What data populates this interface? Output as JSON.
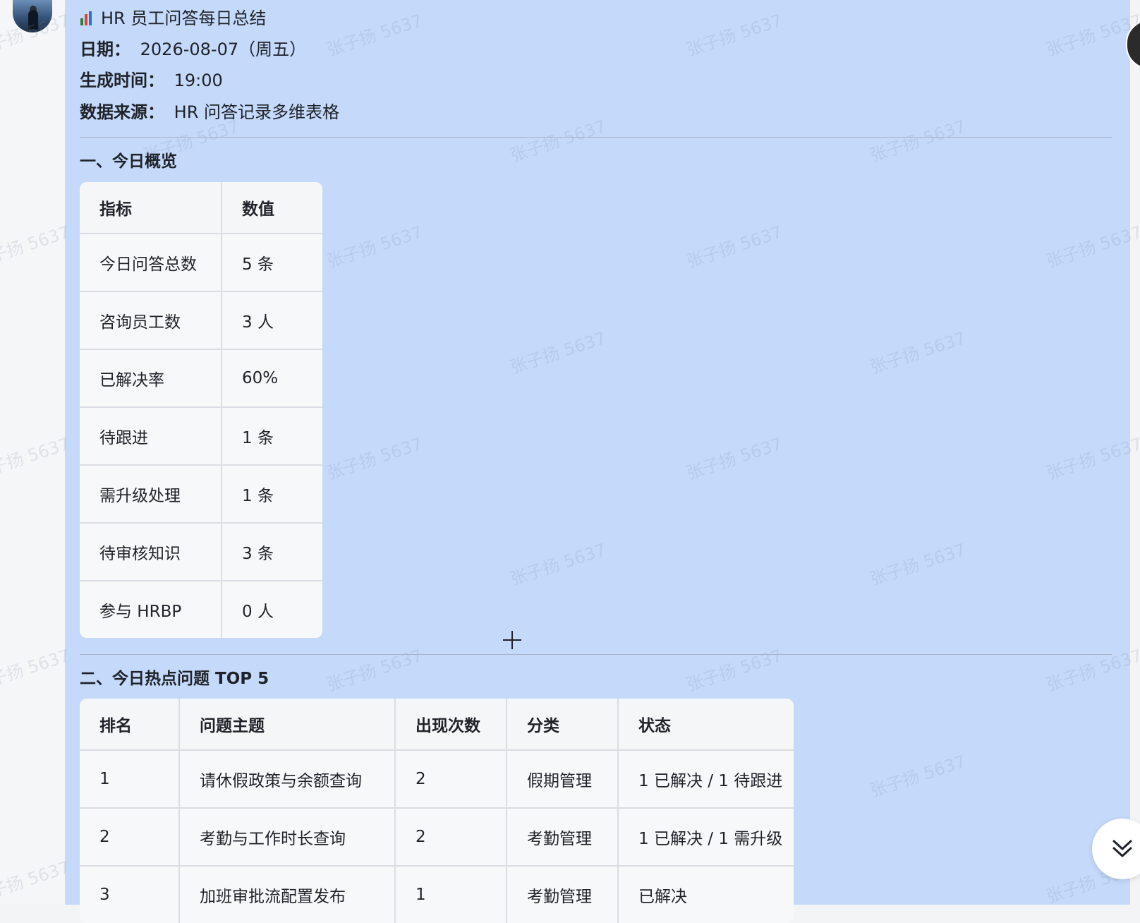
{
  "report": {
    "title": "HR 员工问答每日总结",
    "meta": [
      {
        "key": "日期：",
        "value": "2026-08-07（周五）"
      },
      {
        "key": "生成时间：",
        "value": "19:00"
      },
      {
        "key": "数据来源：",
        "value": "HR 问答记录多维表格"
      }
    ]
  },
  "overview": {
    "title": "一、今日概览",
    "headers": [
      "指标",
      "数值"
    ],
    "rows": [
      [
        "今日问答总数",
        "5 条"
      ],
      [
        "咨询员工数",
        "3 人"
      ],
      [
        "已解决率",
        "60%"
      ],
      [
        "待跟进",
        "1 条"
      ],
      [
        "需升级处理",
        "1 条"
      ],
      [
        "待审核知识",
        "3 条"
      ],
      [
        "参与 HRBP",
        "0 人"
      ]
    ]
  },
  "hot": {
    "title": "二、今日热点问题 TOP 5",
    "headers": [
      "排名",
      "问题主题",
      "出现次数",
      "分类",
      "状态"
    ],
    "rows": [
      [
        "1",
        "请休假政策与余额查询",
        "2",
        "假期管理",
        "1 已解决 / 1 待跟进"
      ],
      [
        "2",
        "考勤与工作时长查询",
        "2",
        "考勤管理",
        "1 已解决 / 1 需升级"
      ],
      [
        "3",
        "加班审批流配置发布",
        "1",
        "考勤管理",
        "已解决"
      ]
    ]
  },
  "watermark": "张子扬 5637",
  "icons": {
    "title_icon": "bar-chart-icon",
    "scroll_icon": "chevron-double-down-icon"
  }
}
